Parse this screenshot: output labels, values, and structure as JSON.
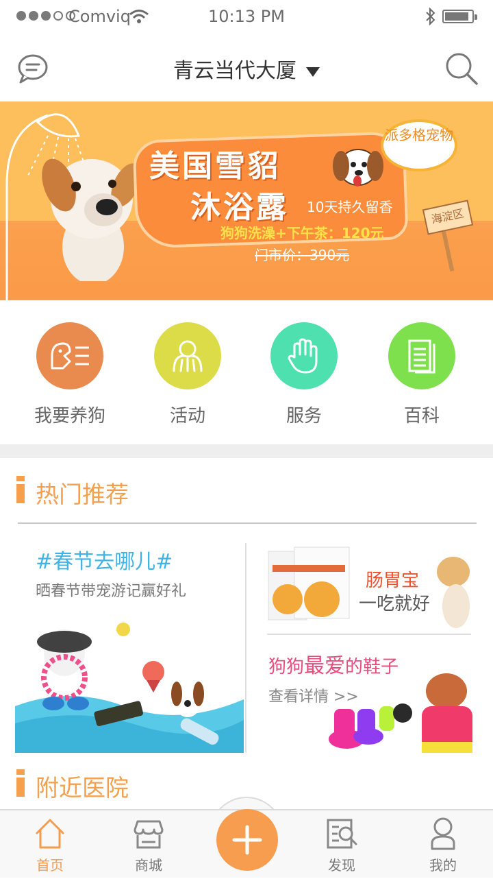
{
  "status_bar": {
    "carrier": "Comviq",
    "time": "10:13 PM"
  },
  "header": {
    "location": "青云当代大厦",
    "chat_icon": "chat-bubble-icon",
    "search_icon": "search-icon"
  },
  "banner": {
    "headline_line1": "美国雪貂",
    "headline_line2": "沐浴露",
    "tagline": "10天持久留香",
    "offer": "狗狗洗澡+下午茶：120元",
    "original_price": "门市价：390元",
    "badge": "派多格宠物",
    "sign": "海淀区"
  },
  "quick_menu": [
    {
      "label": "我要养狗",
      "icon": "dog-adopt-icon",
      "color": "#e98a4f"
    },
    {
      "label": "活动",
      "icon": "activity-icon",
      "color": "#dcdc48"
    },
    {
      "label": "服务",
      "icon": "hand-icon",
      "color": "#4fe0b0"
    },
    {
      "label": "百科",
      "icon": "document-icon",
      "color": "#7ee04d"
    }
  ],
  "sections": {
    "hot": "热门推荐",
    "nearby": "附近医院"
  },
  "promos": {
    "left_title": "#春节去哪儿#",
    "left_sub": "晒春节带宠游记赢好礼",
    "right_top_title": "肠胃宝",
    "right_top_sub": "一吃就好",
    "right_bottom_title_a": "狗狗",
    "right_bottom_title_b": "最爱",
    "right_bottom_title_c": "的鞋子",
    "right_bottom_link": "查看详情 >>"
  },
  "tab_bar": [
    {
      "label": "首页",
      "icon": "home-icon",
      "active": true
    },
    {
      "label": "商城",
      "icon": "store-icon",
      "active": false
    },
    {
      "label": "",
      "icon": "plus-icon",
      "active": false
    },
    {
      "label": "发现",
      "icon": "discover-icon",
      "active": false
    },
    {
      "label": "我的",
      "icon": "profile-icon",
      "active": false
    }
  ],
  "colors": {
    "accent": "#f49b4d",
    "left_promo_title": "#3fb3e3",
    "right_promo_title": "#e94b7c"
  }
}
